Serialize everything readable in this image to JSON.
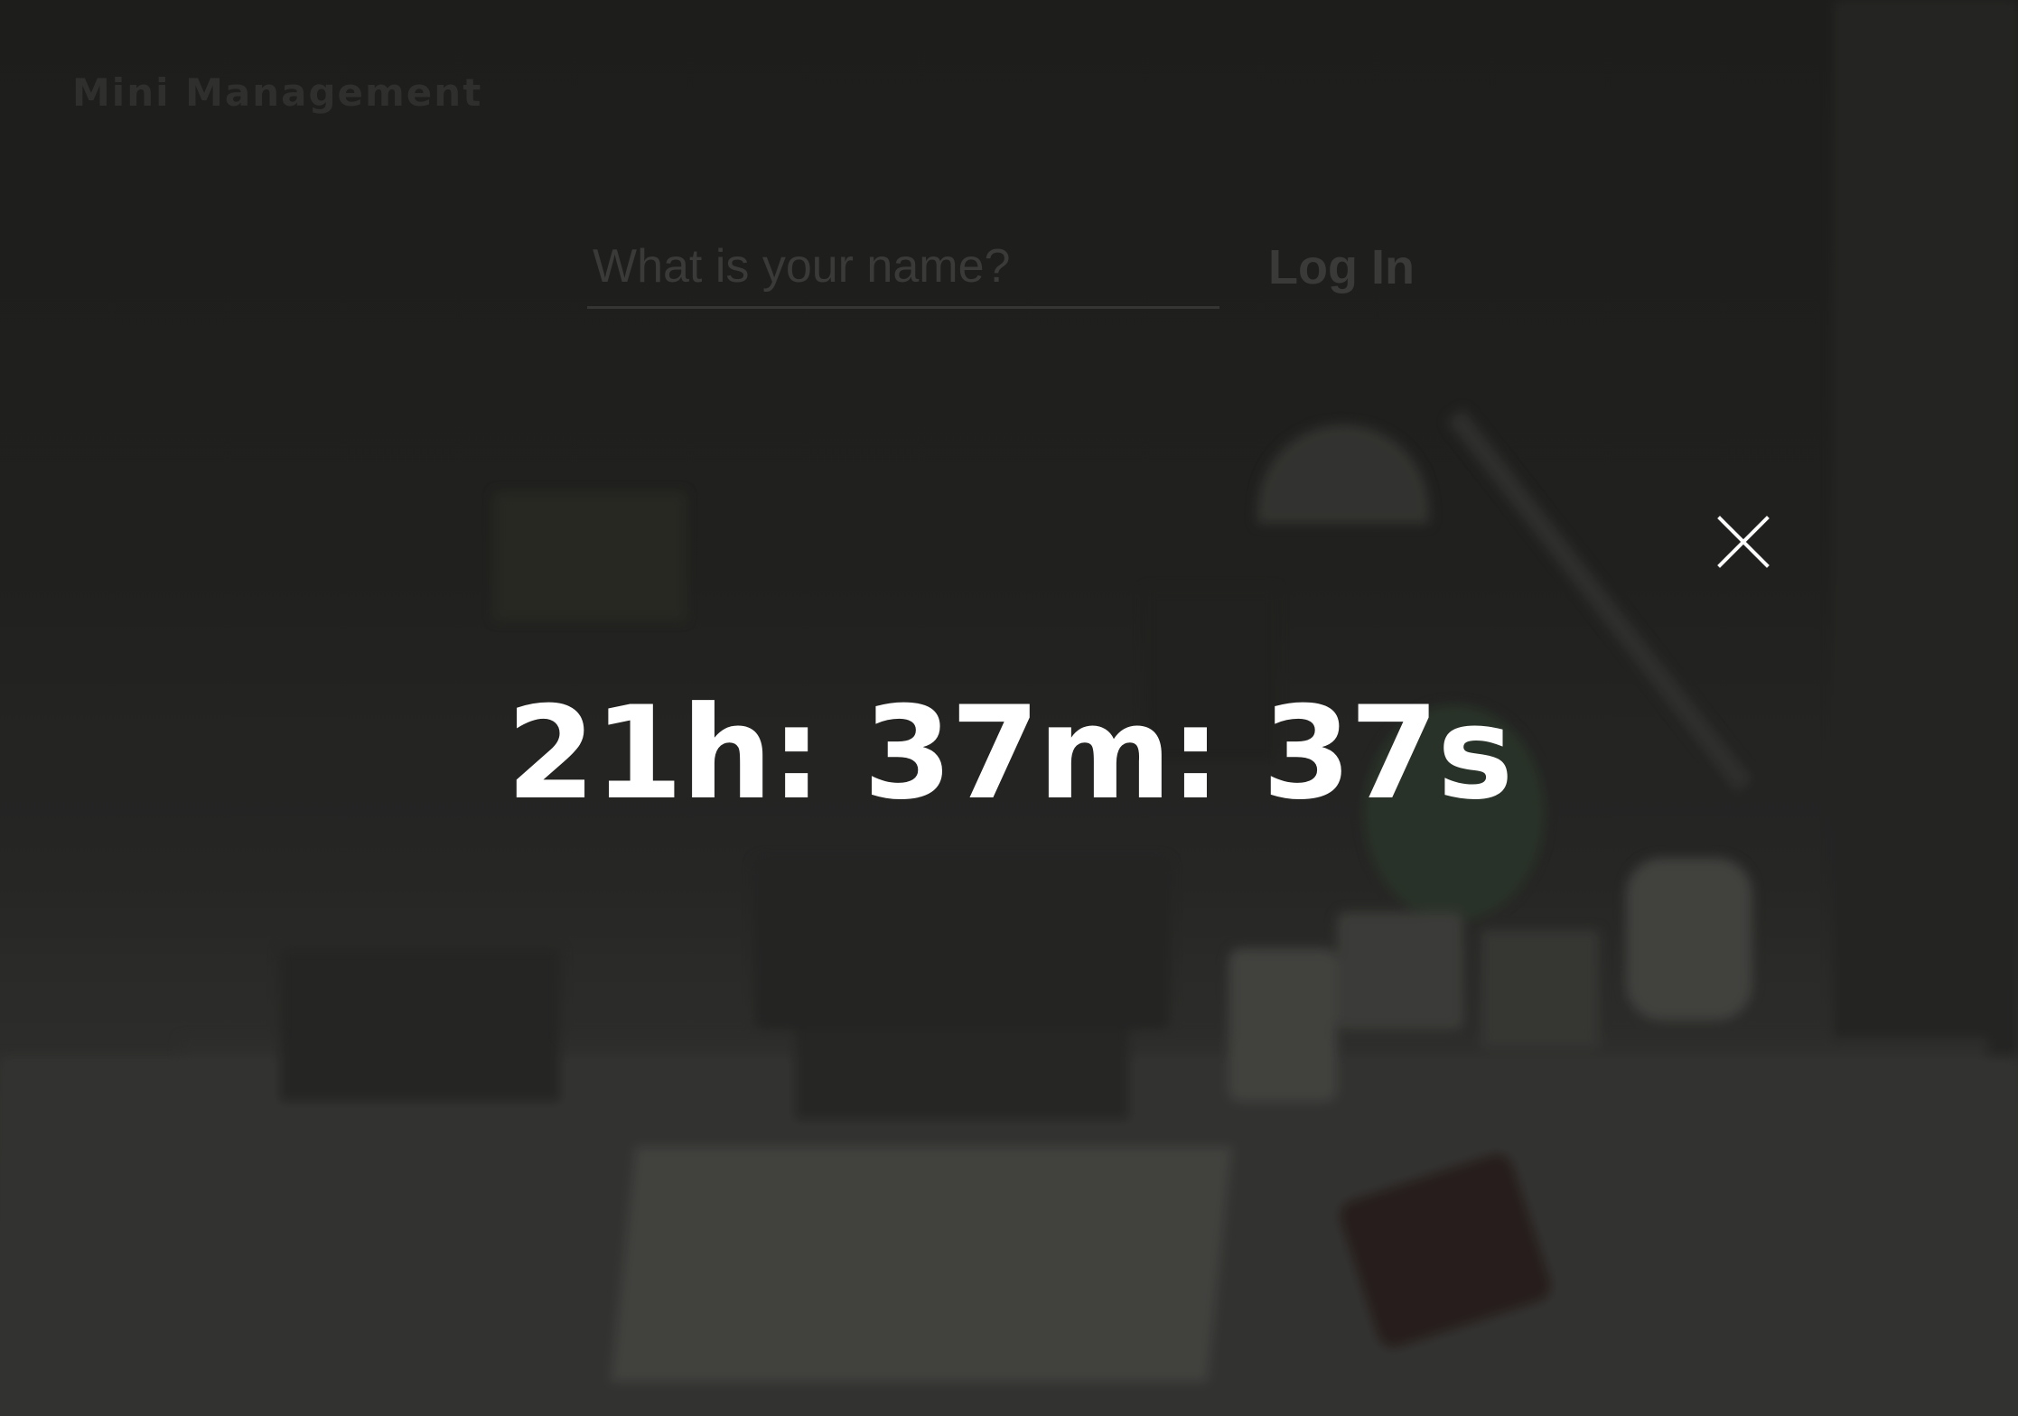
{
  "brand": {
    "text": "Mini Management"
  },
  "login": {
    "name_placeholder": "What is your name?",
    "name_value": "",
    "login_label": "Log In"
  },
  "close": {
    "icon": "close-icon"
  },
  "countdown": {
    "text": "21h: 37m: 37s",
    "hours": 21,
    "minutes": 37,
    "seconds": 37
  },
  "colors": {
    "overlay": "#1f1f1d",
    "countdown_text": "#ffffff",
    "close_icon": "#ffffff"
  }
}
